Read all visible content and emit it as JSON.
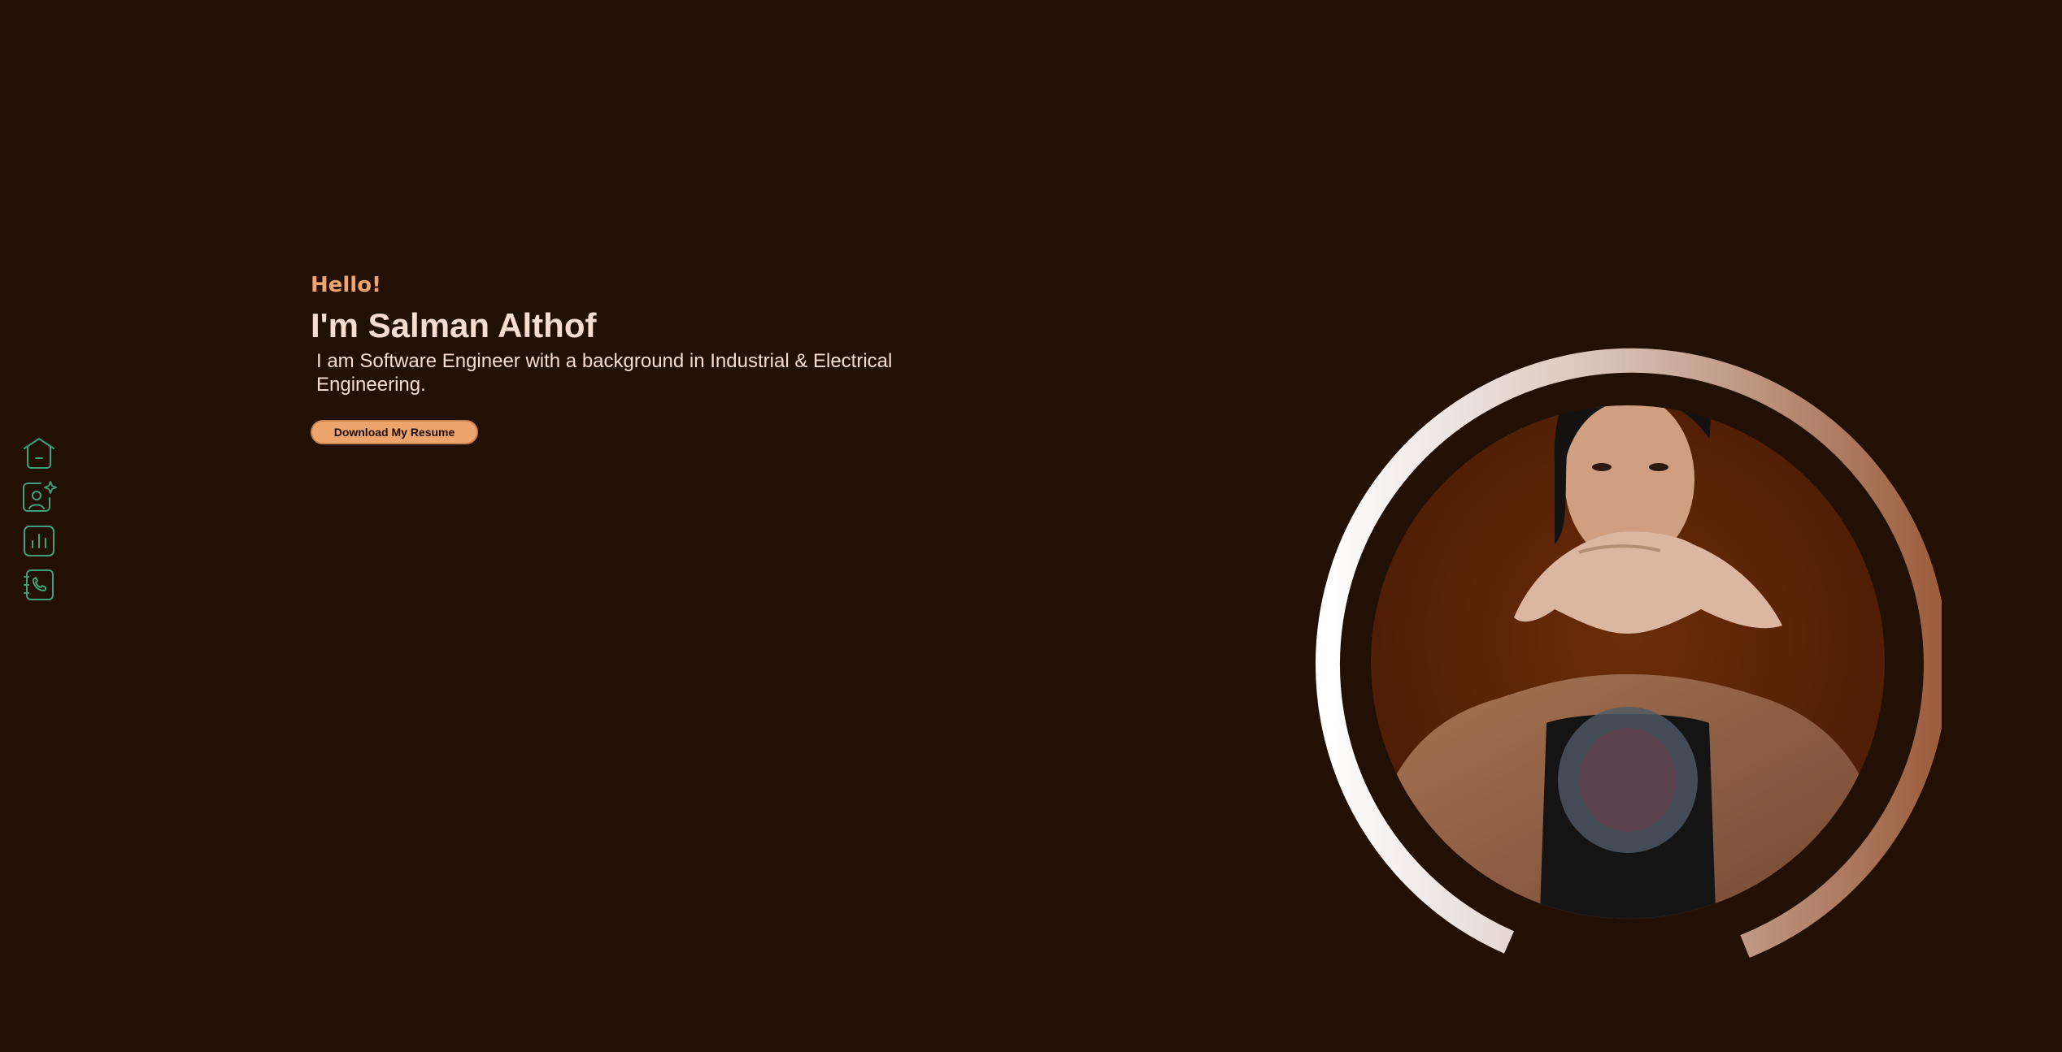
{
  "nav": {
    "items": [
      {
        "name": "home",
        "icon": "home-icon"
      },
      {
        "name": "about",
        "icon": "user-sparkle-icon"
      },
      {
        "name": "skills",
        "icon": "chart-bars-icon"
      },
      {
        "name": "contact",
        "icon": "contact-book-phone-icon"
      }
    ],
    "icon_color": "#3fa079"
  },
  "hero": {
    "greeting": "Hello!",
    "name": "I'm Salman Althof",
    "bio": "I am Software Engineer with a background in Industrial & Electrical Engineering.",
    "resume_button": "Download My Resume"
  },
  "portrait": {
    "subject": "profile-photo",
    "ring_gradient": [
      "#ffffff",
      "#a66848"
    ],
    "backdrop_color": "#5e2606"
  },
  "colors": {
    "background": "#221005",
    "accent": "#eda46d",
    "text": "#f6ddd0"
  }
}
